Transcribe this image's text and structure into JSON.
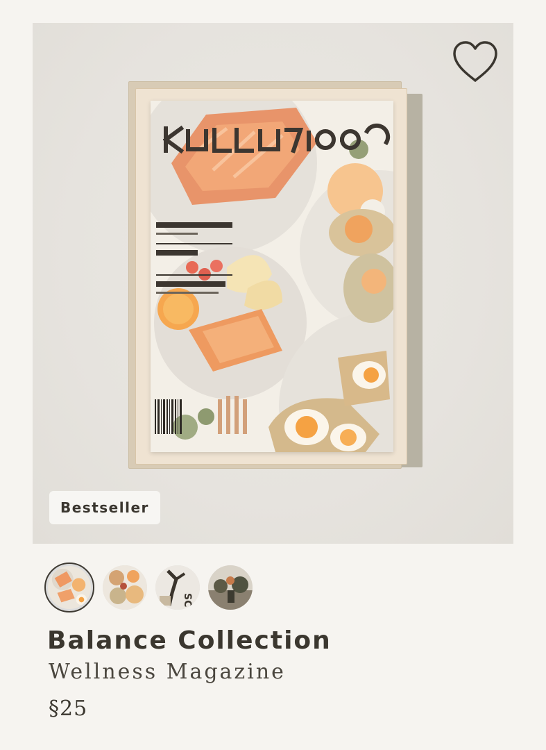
{
  "product": {
    "badge": "Bestseller",
    "title": "Balance Collection",
    "subtitle": "Wellness Magazine",
    "price": "§25"
  },
  "hero": {
    "favorite_icon": "heart-outline-icon",
    "image": "magazine-cover-stack"
  },
  "thumbnails": [
    {
      "name": "thumbnail-1",
      "active": true
    },
    {
      "name": "thumbnail-2",
      "active": false
    },
    {
      "name": "thumbnail-3",
      "active": false
    },
    {
      "name": "thumbnail-4",
      "active": false
    }
  ],
  "colors": {
    "background": "#f6f4f0",
    "text": "#3e3a33",
    "accent_orange": "#f0a35e"
  }
}
